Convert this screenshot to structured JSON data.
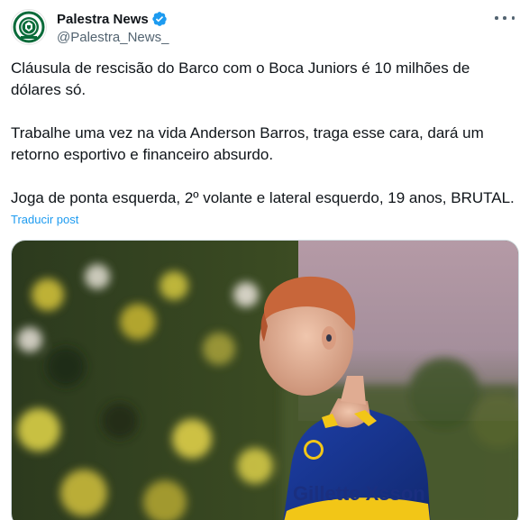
{
  "author": {
    "display_name": "Palestra News",
    "handle": "@Palestra_News_",
    "verified": true,
    "avatar_icon": "club-crest-logo",
    "avatar_logo_text": "PALESTRA NEWS"
  },
  "more_menu_icon": "more-horizontal-icon",
  "tweet": {
    "paragraphs": [
      "Cláusula de rescisão do Barco com o Boca Juniors é 10 milhões de dólares só.",
      "Trabalhe uma vez na vida Anderson Barros, traga esse cara, dará um retorno esportivo e financeiro absurdo.",
      "Joga de ponta esquerda, 2º volante e lateral esquerdo, 19 anos, BRUTAL."
    ],
    "translate_label": "Traducir post"
  },
  "media": {
    "jersey_text": "Gillette Xsson"
  },
  "colors": {
    "text": "#0f1419",
    "secondary": "#536471",
    "link": "#1d9bf0",
    "verified": "#1d9bf0"
  }
}
